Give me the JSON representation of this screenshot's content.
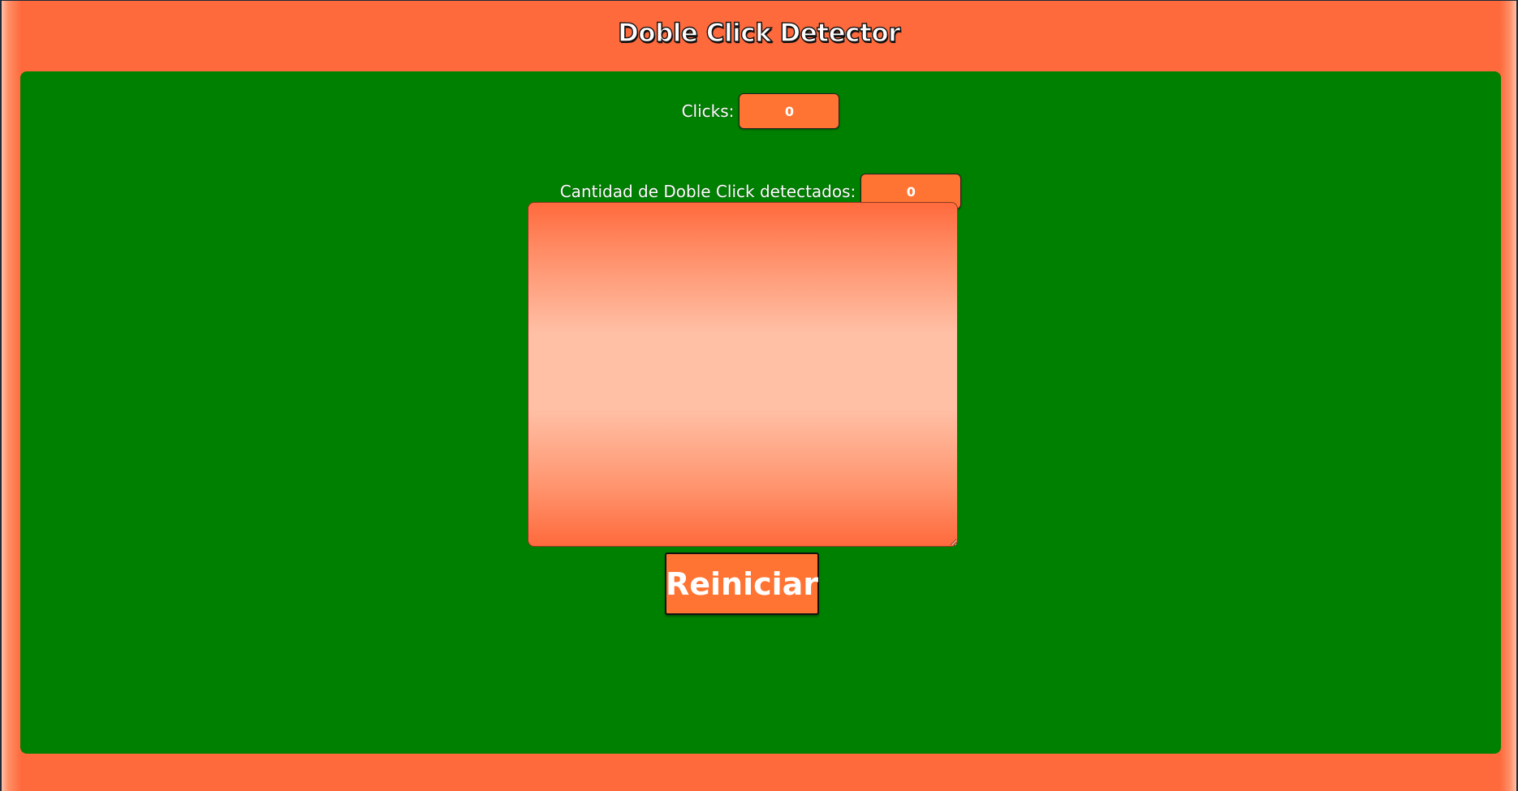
{
  "header": {
    "title": "Doble Click Detector"
  },
  "stats": {
    "clicks_label": "Clicks:",
    "clicks_value": "0",
    "doble_label": "Cantidad de Doble Click detectados:",
    "doble_value": "0"
  },
  "actions": {
    "reset_label": "Reiniciar"
  },
  "colors": {
    "panel": "#008000",
    "accent": "#ff7433",
    "page_bg": "#ff6a3d",
    "area_light": "#ffc0a6"
  }
}
